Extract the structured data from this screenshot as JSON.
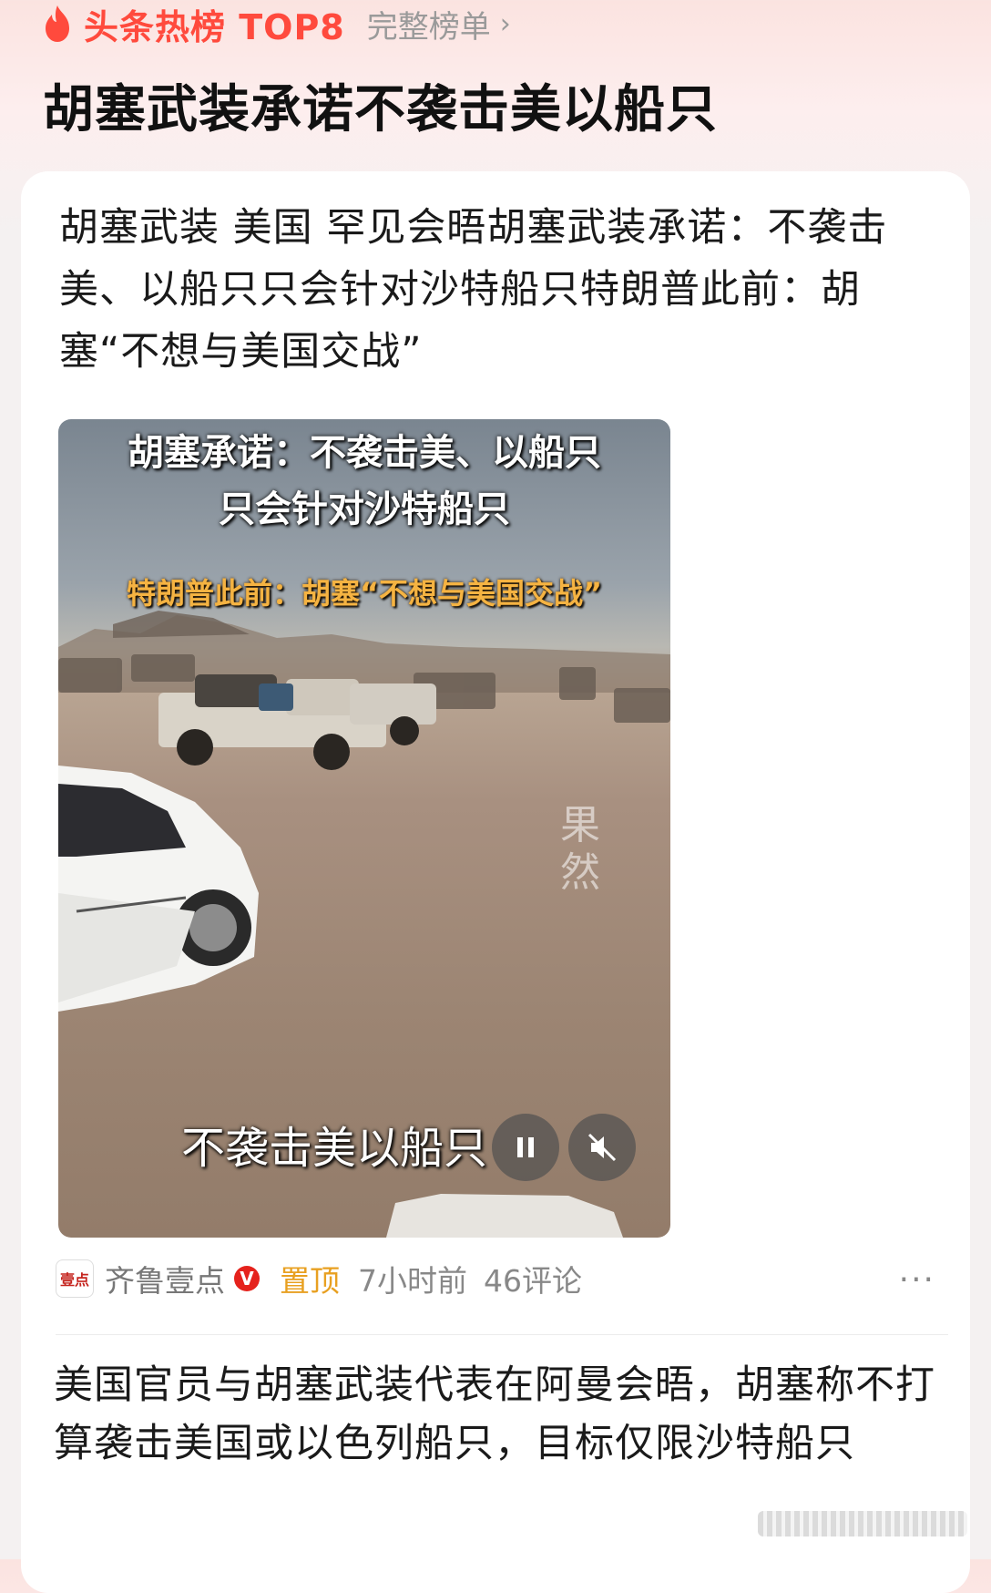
{
  "header": {
    "hot_label": "头条热榜 TOP8",
    "full_list": "完整榜单",
    "chevron": "›",
    "headline": "胡塞武装承诺不袭击美以船只",
    "accent_color": "#ff4a3d"
  },
  "card": {
    "summary": "胡塞武装 美国 罕见会晤胡塞武装承诺：不袭击美、以船只只会针对沙特船只特朗普此前：胡塞“不想与美国交战”",
    "video": {
      "caption_line1": "胡塞承诺：不袭击美、以船只",
      "caption_line2": "只会针对沙特船只",
      "caption_line3": "特朗普此前：胡塞“不想与美国交战”",
      "watermark": "果然",
      "subtitle": "不袭击美以船只",
      "pause_icon": "pause-icon",
      "mute_icon": "mute-icon"
    },
    "meta": {
      "source_logo": "壹点",
      "source": "齐鲁壹点",
      "verified": "V",
      "pinned": "置顶",
      "time": "7小时前",
      "comments": "46评论",
      "more": "···"
    },
    "body": "美国官员与胡塞武装代表在阿曼会晤，胡塞称不打算袭击美国或以色列船只，目标仅限沙特船只"
  }
}
